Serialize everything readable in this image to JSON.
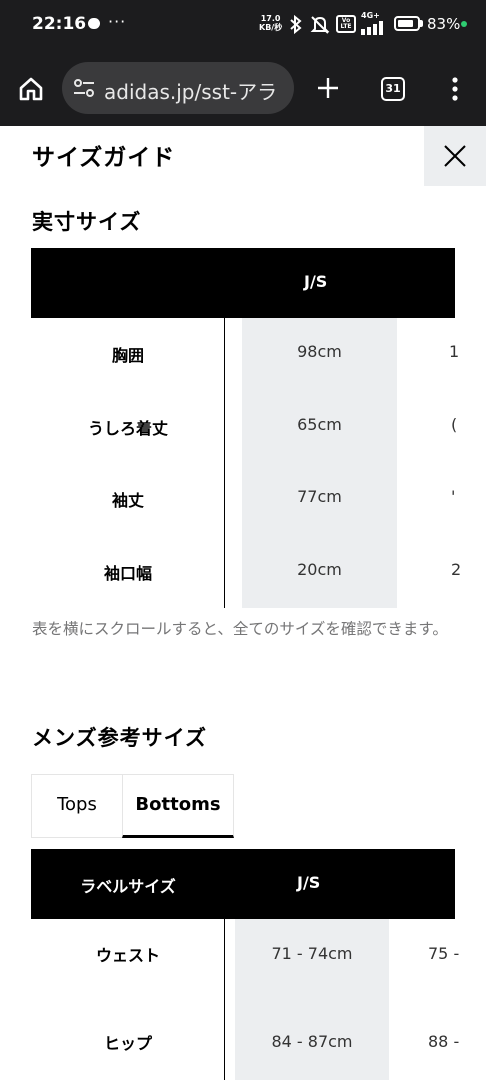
{
  "status_bar": {
    "time": "22:16",
    "net_speed_value": "17.0",
    "net_speed_unit": "KB/秒",
    "network": "4G+",
    "volte": "Vo LTE",
    "battery_percent": "83%",
    "battery_level": 0.83
  },
  "browser": {
    "url": "adidas.jp/sst-アラ",
    "tab_count": "31"
  },
  "page": {
    "title": "サイズガイド",
    "actual_size": {
      "heading": "実寸サイズ",
      "column_header": "J/S",
      "rows": [
        {
          "label": "胸囲",
          "js": "98cm",
          "next": "1"
        },
        {
          "label": "うしろ着丈",
          "js": "65cm",
          "next": "("
        },
        {
          "label": "袖丈",
          "js": "77cm",
          "next": "'"
        },
        {
          "label": "袖口幅",
          "js": "20cm",
          "next": "2"
        }
      ],
      "scroll_note": "表を横にスクロールすると、全てのサイズを確認できます。"
    },
    "mens_reference": {
      "heading": "メンズ参考サイズ",
      "tabs": [
        {
          "label": "Tops",
          "active": false
        },
        {
          "label": "Bottoms",
          "active": true
        }
      ],
      "header_label": "ラベルサイズ",
      "column_header": "J/S",
      "rows": [
        {
          "label": "ウェスト",
          "js": "71 - 74cm",
          "next": "75 -"
        },
        {
          "label": "ヒップ",
          "js": "84 - 87cm",
          "next": "88 -"
        }
      ]
    }
  },
  "colors": {
    "chrome_bg": "#1c1c1e",
    "url_bg": "#3a3a3c",
    "shade": "#eceef0",
    "note_text": "#767677",
    "status_dot": "#2ecc71"
  }
}
